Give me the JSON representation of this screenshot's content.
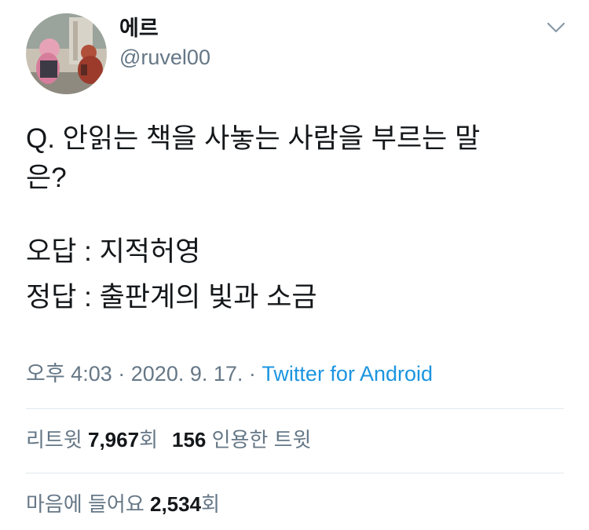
{
  "user": {
    "display_name": "에르",
    "handle": "@ruvel00"
  },
  "tweet": {
    "question_line1": "Q. 안읽는 책을 사놓는 사람을 부르는 말",
    "question_line2": "은?",
    "wrong_answer": "오답 : 지적허영",
    "right_answer": "정답 : 출판계의 빛과 소금"
  },
  "meta": {
    "time": "오후 4:03",
    "separator": "·",
    "date": "2020. 9. 17.",
    "source": "Twitter for Android"
  },
  "stats": {
    "retweets_label": "리트윗",
    "retweets_count": "7,967",
    "retweets_suffix": "회",
    "quotes_count": "156",
    "quotes_label": "인용한 트윗",
    "likes_label": "마음에 들어요",
    "likes_count": "2,534",
    "likes_suffix": "회"
  },
  "icons": {
    "caret": "chevron-down-icon"
  },
  "colors": {
    "text": "#14171a",
    "secondary": "#657786",
    "link": "#1b95e0",
    "divider": "#e1e8ed"
  }
}
